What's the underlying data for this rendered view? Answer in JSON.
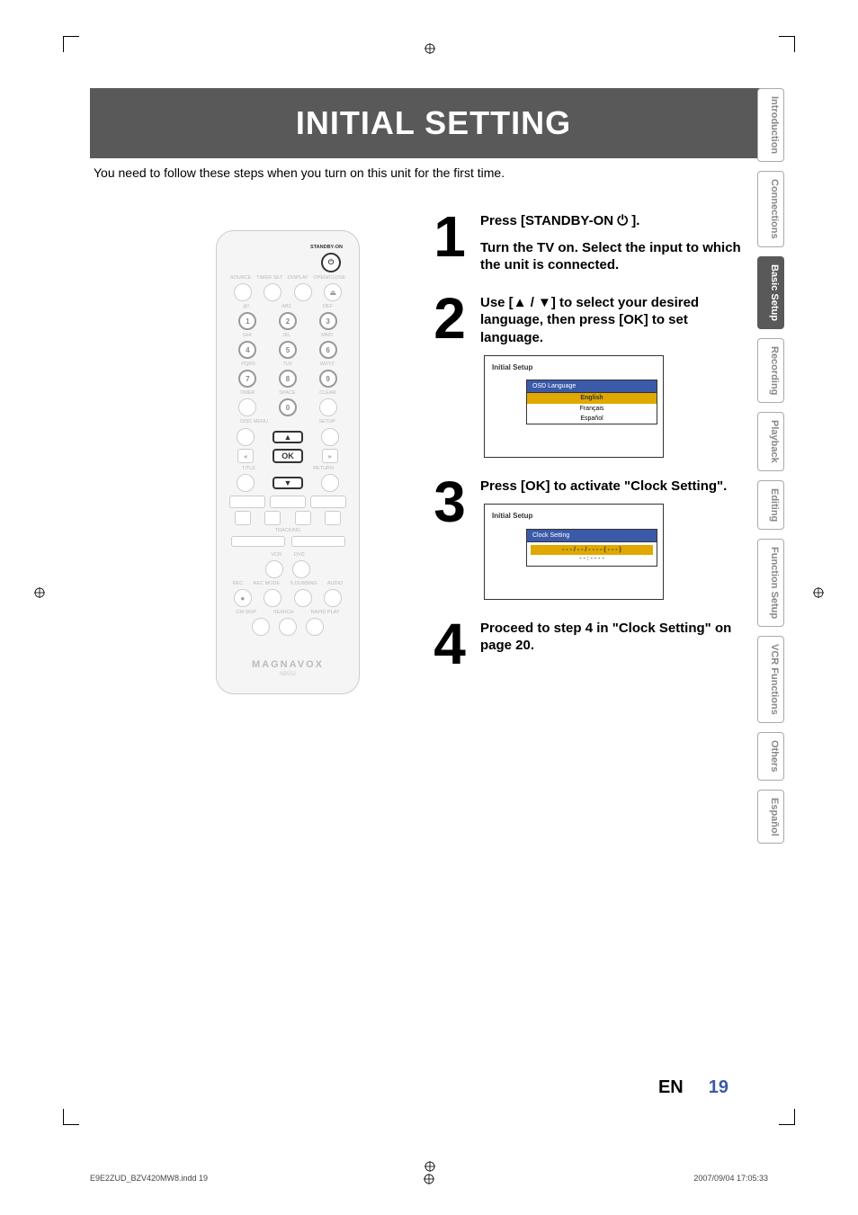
{
  "banner": "INITIAL SETTING",
  "intro": "You need to follow these steps when you turn on this unit for the first time.",
  "tabs": [
    {
      "label": "Introduction",
      "active": false
    },
    {
      "label": "Connections",
      "active": false
    },
    {
      "label": "Basic Setup",
      "active": true
    },
    {
      "label": "Recording",
      "active": false
    },
    {
      "label": "Playback",
      "active": false
    },
    {
      "label": "Editing",
      "active": false
    },
    {
      "label": "Function Setup",
      "active": false
    },
    {
      "label": "VCR Functions",
      "active": false
    },
    {
      "label": "Others",
      "active": false
    },
    {
      "label": "Español",
      "active": false
    }
  ],
  "remote": {
    "standby_label": "STANDBY-ON",
    "top_labels": [
      "SOURCE",
      "TIMER SET",
      "DISPLAY",
      "OPEN/CLOSE"
    ],
    "num_row1_labels": [
      "@!.",
      "ABC",
      "DEF"
    ],
    "num_row1": [
      "1",
      "2",
      "3"
    ],
    "num_row2_labels": [
      "GHI",
      "JKL",
      "MNO"
    ],
    "num_row2": [
      "4",
      "5",
      "6"
    ],
    "num_row3_labels": [
      "PQRS",
      "TUV",
      "WXYZ"
    ],
    "num_row3": [
      "7",
      "8",
      "9"
    ],
    "num_row4_labels": [
      "TIMER",
      "SPACE",
      "CLEAR"
    ],
    "num_row4": [
      "",
      "0",
      ""
    ],
    "discmenu": "DISC MENU",
    "setup": "SETUP",
    "ok": "OK",
    "title": "TITLE",
    "return": "RETURN",
    "tracking": "TRACKING",
    "vcr_dvd": [
      "VCR",
      "DVD"
    ],
    "bottom_labels": [
      "REC",
      "REC MODE",
      "S.DUBBING",
      "AUDIO"
    ],
    "bottom2_labels": [
      "CM SKIP",
      "SEARCH",
      "RAPID PLAY"
    ],
    "brand": "MAGNAVOX",
    "model": "NB552"
  },
  "steps": {
    "s1": {
      "num": "1",
      "line1": "Press [STANDBY-ON ⏻ ].",
      "line2": "Turn the TV on. Select the input to which the unit is connected."
    },
    "s2": {
      "num": "2",
      "text": "Use [▲ / ▼] to select your desired language, then press [OK] to set language.",
      "osd_title": "Initial Setup",
      "osd_heading": "OSD Language",
      "opts": [
        "English",
        "Français",
        "Español"
      ]
    },
    "s3": {
      "num": "3",
      "text": "Press [OK] to activate \"Clock Setting\".",
      "osd_title": "Initial Setup",
      "osd_heading": "Clock Setting",
      "clock_line1": "- - - / - - / - - - - ( - - - )",
      "clock_line2": "- - : - - - -"
    },
    "s4": {
      "num": "4",
      "text": "Proceed to step 4 in \"Clock Setting\" on page 20."
    }
  },
  "footer": {
    "lang": "EN",
    "page": "19"
  },
  "printline": {
    "left": "E9E2ZUD_BZV420MW8.indd   19",
    "right": "2007/09/04   17:05:33"
  }
}
